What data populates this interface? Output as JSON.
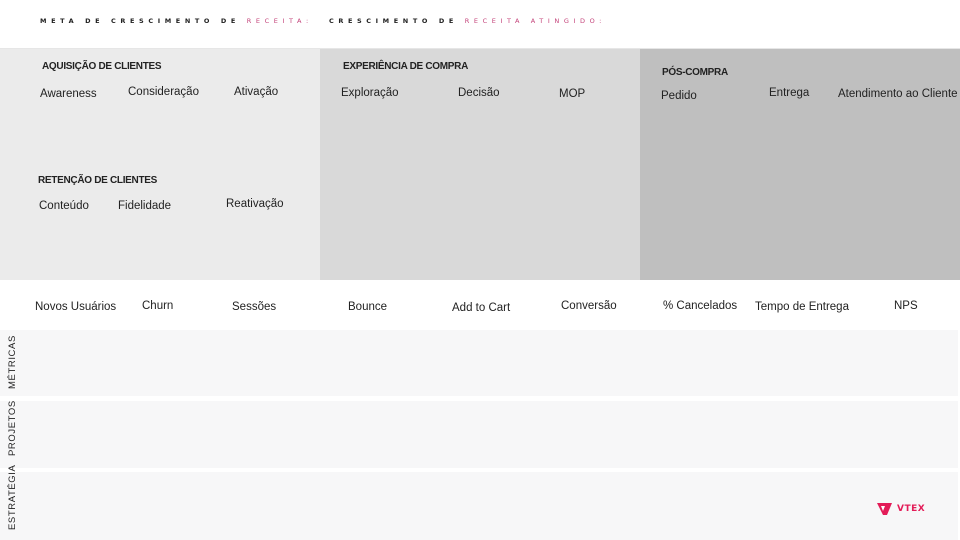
{
  "header": {
    "meta": {
      "prefix": "META DE CRESCIMENTO DE ",
      "accent": "RECEITA:"
    },
    "atingido": {
      "prefix": "CRESCIMENTO DE ",
      "accent": "RECEITA ATINGIDO:"
    }
  },
  "panels": {
    "aquisicao": {
      "title": "AQUISIÇÃO DE CLIENTES",
      "stages": [
        "Awareness",
        "Consideração",
        "Ativação"
      ]
    },
    "retencao": {
      "title": "RETENÇÃO DE CLIENTES",
      "stages": [
        "Conteúdo",
        "Fidelidade",
        "Reativação"
      ]
    },
    "experiencia": {
      "title": "EXPERIÊNCIA DE COMPRA",
      "stages": [
        "Exploração",
        "Decisão",
        "MOP"
      ]
    },
    "pos_compra": {
      "title": "PÓS-COMPRA",
      "stages": [
        "Pedido",
        "Entrega",
        "Atendimento ao Cliente"
      ]
    }
  },
  "metrics": [
    "Novos Usuários",
    "Churn",
    "Sessões",
    "Bounce",
    "Add to Cart",
    "Conversão",
    "% Cancelados",
    "Tempo de Entrega",
    "NPS"
  ],
  "rows": {
    "metricas": "MÉTRICAS",
    "projetos": "PROJETOS",
    "estrategia": "ESTRATÉGIA"
  },
  "logo": {
    "text": "VTEX",
    "icon": "vtex-logo-icon"
  },
  "colors": {
    "accent": "#c4437a",
    "brand": "#e31c58",
    "panel_aquisicao": "#ebebeb",
    "panel_experiencia": "#d9d9d9",
    "panel_pos": "#bfbfbf",
    "row_bg": "#f7f7f8"
  }
}
